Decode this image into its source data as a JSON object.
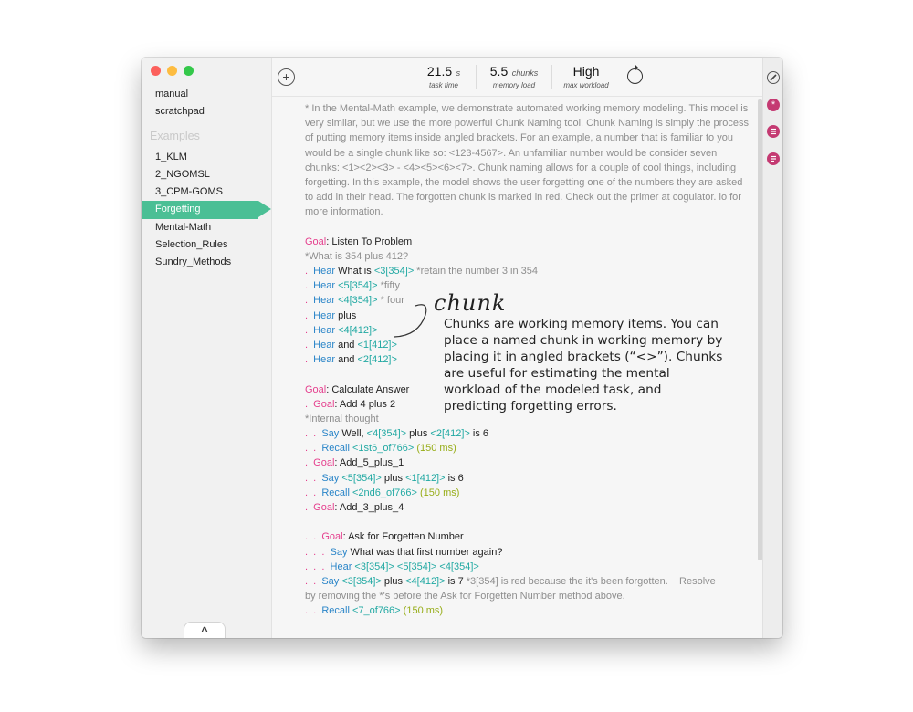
{
  "sidebar": {
    "items_top": [
      "manual",
      "scratchpad"
    ],
    "examples_header": "Examples",
    "items": [
      "1_KLM",
      "2_NGOMSL",
      "3_CPM-GOMS",
      "Forgetting",
      "Mental-Math",
      "Selection_Rules",
      "Sundry_Methods"
    ],
    "selected": "Forgetting",
    "collapse_label": "^"
  },
  "toolbar": {
    "add_label": "+",
    "task_time": {
      "value": "21.5",
      "unit": "s",
      "label": "task time"
    },
    "memory_load": {
      "value": "5.5",
      "unit": "chunks",
      "label": "memory load"
    },
    "max_workload": {
      "value": "High",
      "label": "max workload"
    }
  },
  "editor": {
    "intro": "* In the Mental-Math example, we demonstrate automated working memory modeling.    This model is very similar, but we use the more powerful Chunk Naming tool.    Chunk Naming is simply the process of putting memory items inside angled brackets.    For an example, a number that is familiar to you would be a single chunk like so: <123-4567>.    An unfamiliar number would be consider seven chunks: <1><2><3> - <4><5><6><7>.    Chunk naming allows for a couple of cool things, including forgetting.    In this example, the model shows the user forgetting one of the numbers they are asked to add in their head.    The forgotten chunk is marked in red.    Check out the primer at cogulator.   io for more information.",
    "lines": [
      [
        [
          "goal",
          "Goal"
        ],
        [
          "t",
          ": Listen To Problem"
        ]
      ],
      [
        [
          "c",
          "*What is 354 plus 412?"
        ]
      ],
      [
        [
          "d",
          ".  "
        ],
        [
          "op",
          "Hear"
        ],
        [
          "t",
          " What is "
        ],
        [
          "ch",
          "<3[354]>"
        ],
        [
          "c",
          " *retain the number 3 in 354"
        ]
      ],
      [
        [
          "d",
          ".  "
        ],
        [
          "op",
          "Hear"
        ],
        [
          "t",
          " "
        ],
        [
          "ch",
          "<5[354]>"
        ],
        [
          "c",
          " *fifty"
        ]
      ],
      [
        [
          "d",
          ".  "
        ],
        [
          "op",
          "Hear"
        ],
        [
          "t",
          " "
        ],
        [
          "ch",
          "<4[354]>"
        ],
        [
          "c",
          " * four"
        ]
      ],
      [
        [
          "d",
          ".  "
        ],
        [
          "op",
          "Hear"
        ],
        [
          "t",
          " plus"
        ]
      ],
      [
        [
          "d",
          ".  "
        ],
        [
          "op",
          "Hear"
        ],
        [
          "t",
          " "
        ],
        [
          "ch",
          "<4[412]>"
        ]
      ],
      [
        [
          "d",
          ".  "
        ],
        [
          "op",
          "Hear"
        ],
        [
          "t",
          " and "
        ],
        [
          "ch",
          "<1[412]>"
        ]
      ],
      [
        [
          "d",
          ".  "
        ],
        [
          "op",
          "Hear"
        ],
        [
          "t",
          " and "
        ],
        [
          "ch",
          "<2[412]>"
        ]
      ],
      [],
      [
        [
          "goal",
          "Goal"
        ],
        [
          "t",
          ": Calculate Answer"
        ]
      ],
      [
        [
          "d",
          ".  "
        ],
        [
          "goal",
          "Goal"
        ],
        [
          "t",
          ": Add 4 plus 2"
        ]
      ],
      [
        [
          "c",
          "*Internal thought"
        ]
      ],
      [
        [
          "d",
          ".  .  "
        ],
        [
          "op",
          "Say"
        ],
        [
          "t",
          " Well, "
        ],
        [
          "ch",
          "<4[354]>"
        ],
        [
          "t",
          " plus "
        ],
        [
          "ch",
          "<2[412]>"
        ],
        [
          "t",
          " is 6"
        ]
      ],
      [
        [
          "d",
          ".  .  "
        ],
        [
          "op",
          "Recall"
        ],
        [
          "t",
          " "
        ],
        [
          "ch",
          "<1st6_of766>"
        ],
        [
          "t",
          " "
        ],
        [
          "du",
          "(150 ms)"
        ]
      ],
      [
        [
          "d",
          ".  "
        ],
        [
          "goal",
          "Goal"
        ],
        [
          "t",
          ": Add_5_plus_1"
        ]
      ],
      [
        [
          "d",
          ".  .  "
        ],
        [
          "op",
          "Say"
        ],
        [
          "t",
          " "
        ],
        [
          "ch",
          "<5[354]>"
        ],
        [
          "t",
          " plus "
        ],
        [
          "ch",
          "<1[412]>"
        ],
        [
          "t",
          " is 6"
        ]
      ],
      [
        [
          "d",
          ".  .  "
        ],
        [
          "op",
          "Recall"
        ],
        [
          "t",
          " "
        ],
        [
          "ch",
          "<2nd6_of766>"
        ],
        [
          "t",
          " "
        ],
        [
          "du",
          "(150 ms)"
        ]
      ],
      [
        [
          "d",
          ".  "
        ],
        [
          "goal",
          "Goal"
        ],
        [
          "t",
          ": Add_3_plus_4"
        ]
      ],
      [],
      [
        [
          "d",
          ".  .  "
        ],
        [
          "goal",
          "Goal"
        ],
        [
          "t",
          ": Ask for Forgetten Number"
        ]
      ],
      [
        [
          "d",
          ".  .  .  "
        ],
        [
          "op",
          "Say"
        ],
        [
          "t",
          " What was that first number again?"
        ]
      ],
      [
        [
          "d",
          ".  .  .  "
        ],
        [
          "op",
          "Hear"
        ],
        [
          "t",
          " "
        ],
        [
          "ch",
          "<3[354]> <5[354]> <4[354]>"
        ]
      ],
      [
        [
          "d",
          ".  .  "
        ],
        [
          "op",
          "Say"
        ],
        [
          "t",
          " "
        ],
        [
          "ch",
          "<3[354]>"
        ],
        [
          "t",
          " plus "
        ],
        [
          "ch",
          "<4[412]>"
        ],
        [
          "t",
          " is 7 "
        ],
        [
          "c",
          "*3[354] is red because the it's been forgotten.    Resolve"
        ]
      ],
      [
        [
          "c",
          "by removing the *'s before the Ask for Forgetten Number method above."
        ]
      ],
      [
        [
          "d",
          ".  .  "
        ],
        [
          "op",
          "Recall"
        ],
        [
          "t",
          " "
        ],
        [
          "ch",
          "<7_of766>"
        ],
        [
          "t",
          " "
        ],
        [
          "du",
          "(150 ms)"
        ]
      ]
    ]
  },
  "annotation": {
    "title": "chunk",
    "text": "Chunks are working memory items.  You can place a named chunk in working memory by placing it in angled brackets (“<>”).  Chunks are useful for estimating the mental workload of the modeled task, and predicting forgetting errors."
  },
  "rightbar": {
    "icons": [
      "pencil-icon",
      "asterisk-icon",
      "list-icon",
      "notes-icon"
    ]
  },
  "colors": {
    "selected_bg": "#4bbf95",
    "goal": "#e5408e",
    "operator": "#2a85c8",
    "chunk": "#22a9a3",
    "duration": "#97ad18",
    "comment": "#8e8e8e"
  }
}
